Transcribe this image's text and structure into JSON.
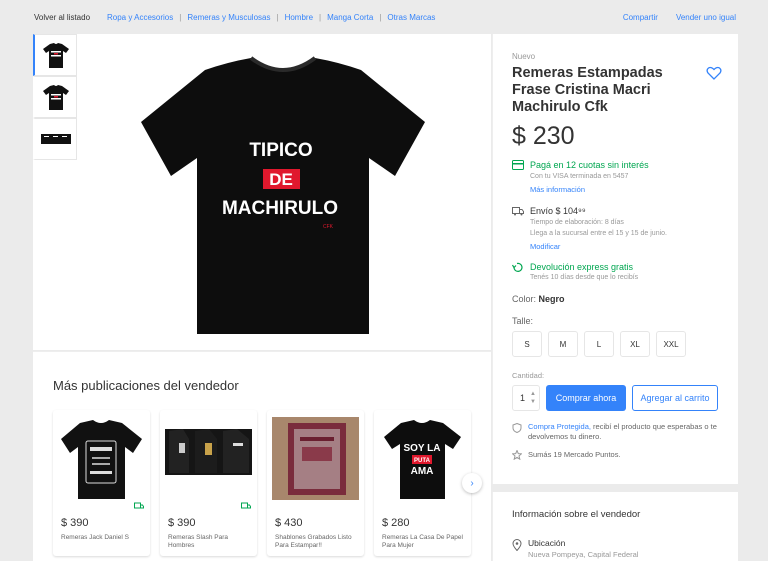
{
  "topbar": {
    "back": "Volver al listado",
    "breadcrumbs": [
      "Ropa y Accesorios",
      "Remeras y Musculosas",
      "Hombre",
      "Manga Corta",
      "Otras Marcas"
    ],
    "links": [
      "Compartir",
      "Vender uno igual"
    ]
  },
  "product": {
    "condition": "Nuevo",
    "title": "Remeras Estampadas Frase Cristina Macri Machirulo Cfk",
    "price": "$ 230",
    "shirt_text": {
      "line1": "TIPICO",
      "line2": "DE",
      "line3": "MACHIRULO",
      "tag": "CFK"
    }
  },
  "payment": {
    "title": "Pagá en 12 cuotas sin interés",
    "sub": "Con tu VISA terminada en 5457",
    "link": "Más información"
  },
  "shipping": {
    "title": "Envío $ 104⁹⁹",
    "sub1": "Tiempo de elaboración: 8 días",
    "sub2": "Llega a la sucursal entre el 15 y 15 de junio.",
    "link": "Modificar"
  },
  "returns": {
    "title": "Devolución express gratis",
    "sub": "Tenés 10 días desde que lo recibís"
  },
  "color": {
    "label": "Color:",
    "value": "Negro"
  },
  "talle": {
    "label": "Talle:",
    "options": [
      "S",
      "M",
      "L",
      "XL",
      "XXL"
    ]
  },
  "cantidad": {
    "label": "Cantidad:",
    "value": "1"
  },
  "buttons": {
    "buy": "Comprar ahora",
    "cart": "Agregar al carrito"
  },
  "protection": {
    "link": "Compra Protegida,",
    "text": " recibí el producto que esperabas o te devolvemos tu dinero."
  },
  "points": "Sumás 19 Mercado Puntos.",
  "seller": {
    "title": "Información sobre el vendedor",
    "location_label": "Ubicación",
    "location": "Nueva Pompeya, Capital Federal"
  },
  "more": {
    "title": "Más publicaciones del vendedor",
    "items": [
      {
        "price": "$ 390",
        "name": "Remeras Jack Daniel S"
      },
      {
        "price": "$ 390",
        "name": "Remeras Slash Para Hombres"
      },
      {
        "price": "$ 430",
        "name": "Shablones Grabados Listo Para Estampar!!"
      },
      {
        "price": "$ 280",
        "name": "Remeras La Casa De Papel Para Mujer"
      }
    ],
    "item4_shirt": {
      "l1": "SOY LA",
      "l2": "PUTA",
      "l3": "AMA"
    }
  },
  "colors": {
    "accent": "#3483fa",
    "green": "#00a650",
    "red": "#e0182d"
  }
}
